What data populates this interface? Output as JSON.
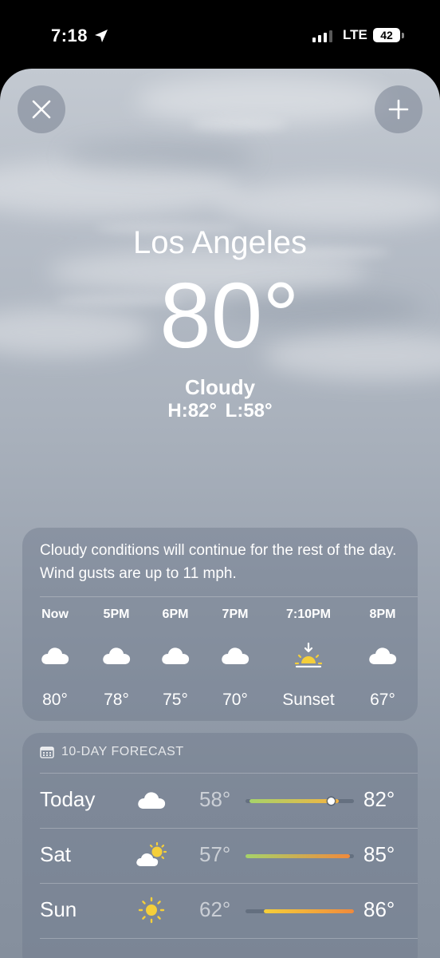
{
  "status_bar": {
    "time": "7:18",
    "network": "LTE",
    "battery": "42"
  },
  "header": {
    "city": "Los Angeles",
    "temperature": "80°",
    "condition": "Cloudy",
    "high_low": "H:82°  L:58°"
  },
  "hourly": {
    "summary": "Cloudy conditions will continue for the rest of the day. Wind gusts are up to 11 mph.",
    "items": [
      {
        "label": "Now",
        "icon": "cloud-icon",
        "temp": "80°"
      },
      {
        "label": "5PM",
        "icon": "cloud-icon",
        "temp": "78°"
      },
      {
        "label": "6PM",
        "icon": "cloud-icon",
        "temp": "75°"
      },
      {
        "label": "7PM",
        "icon": "cloud-icon",
        "temp": "70°"
      },
      {
        "label": "7:10PM",
        "icon": "sunset-icon",
        "temp": "Sunset"
      },
      {
        "label": "8PM",
        "icon": "cloud-icon",
        "temp": "67°"
      }
    ]
  },
  "forecast": {
    "title": "10-DAY FORECAST",
    "range_min": 57,
    "range_max": 86,
    "days": [
      {
        "day": "Today",
        "icon": "cloud-icon",
        "low": "58°",
        "high": "82°",
        "low_value": 58,
        "high_value": 82,
        "current_value": 80,
        "bar_colors": [
          "#a6d36a",
          "#f5b441"
        ]
      },
      {
        "day": "Sat",
        "icon": "partly-sunny-icon",
        "low": "57°",
        "high": "85°",
        "low_value": 57,
        "high_value": 85,
        "bar_colors": [
          "#a6d36a",
          "#f08a3c"
        ]
      },
      {
        "day": "Sun",
        "icon": "sun-icon",
        "low": "62°",
        "high": "86°",
        "low_value": 62,
        "high_value": 86,
        "bar_colors": [
          "#f5cf3a",
          "#f08a3c"
        ]
      }
    ]
  }
}
